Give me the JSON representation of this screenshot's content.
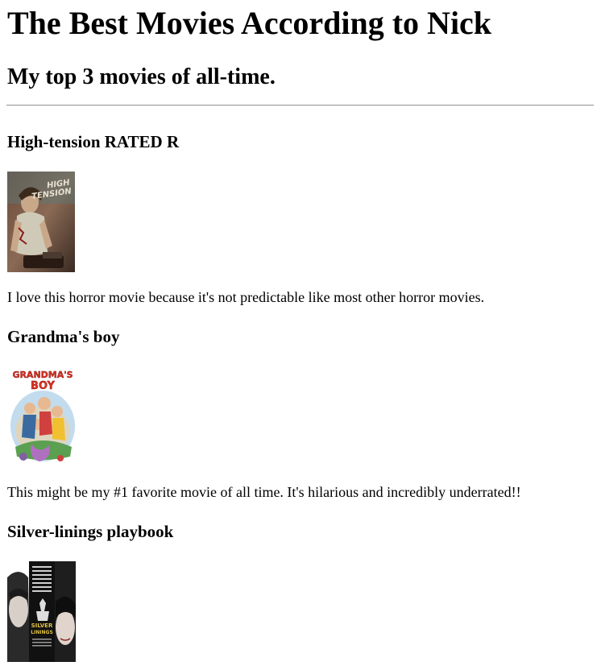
{
  "page": {
    "title": "The Best Movies According to Nick",
    "subtitle": "My top 3 movies of all-time."
  },
  "movies": [
    {
      "title": "High-tension RATED R",
      "poster_text": [
        "HIGH",
        "TENSION"
      ],
      "description": "I love this horror movie because it's not predictable like most other horror movies."
    },
    {
      "title": "Grandma's boy",
      "poster_text": [
        "GRANDMA'S",
        "BOY"
      ],
      "description": "This might be my #1 favorite movie of all time. It's hilarious and incredibly underrated!!"
    },
    {
      "title": "Silver-linings playbook",
      "poster_text": [
        "SILVER",
        "LININGS"
      ],
      "description": ""
    }
  ]
}
